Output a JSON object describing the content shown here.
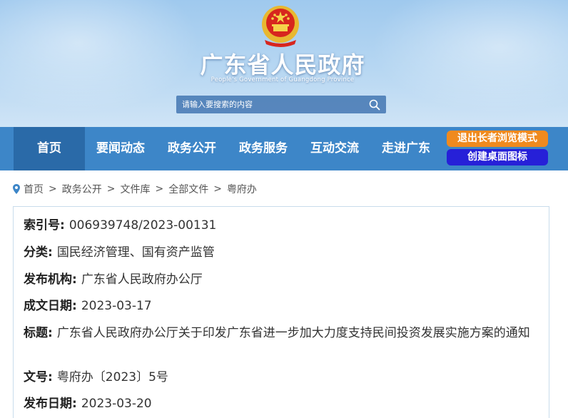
{
  "header": {
    "title": "广东省人民政府",
    "subtitle": "People's Government of Guangdong Province",
    "emblem_icon": "national-emblem-icon"
  },
  "search": {
    "placeholder": "请输入要搜索的内容",
    "icon": "search-icon"
  },
  "nav": {
    "items": [
      {
        "label": "首页",
        "active": true
      },
      {
        "label": "要闻动态",
        "active": false
      },
      {
        "label": "政务公开",
        "active": false
      },
      {
        "label": "政务服务",
        "active": false
      },
      {
        "label": "互动交流",
        "active": false
      },
      {
        "label": "走进广东",
        "active": false
      }
    ],
    "exit_elder_mode": "退出长者浏览模式",
    "create_desktop_icon": "创建桌面图标"
  },
  "breadcrumb": {
    "items": [
      "首页",
      "政务公开",
      "文件库",
      "全部文件",
      "粤府办"
    ],
    "separator": ">",
    "icon": "location-pin-icon"
  },
  "info": {
    "index_label": "索引号:",
    "index_value": "006939748/2023-00131",
    "category_label": "分类:",
    "category_value": "国民经济管理、国有资产监管",
    "publisher_label": "发布机构:",
    "publisher_value": "广东省人民政府办公厅",
    "date_written_label": "成文日期:",
    "date_written_value": "2023-03-17",
    "title_label": "标题:",
    "title_value": "广东省人民政府办公厅关于印发广东省进一步加大力度支持民间投资发展实施方案的通知",
    "doc_no_label": "文号:",
    "doc_no_value": "粤府办〔2023〕5号",
    "publish_date_label": "发布日期:",
    "publish_date_value": "2023-03-20"
  },
  "colors": {
    "nav_bg": "#3d86c8",
    "nav_active": "#2a6aa8",
    "exit_btn": "#f08a1e",
    "desk_btn": "#2620d8",
    "panel_border": "#c9dcec"
  }
}
